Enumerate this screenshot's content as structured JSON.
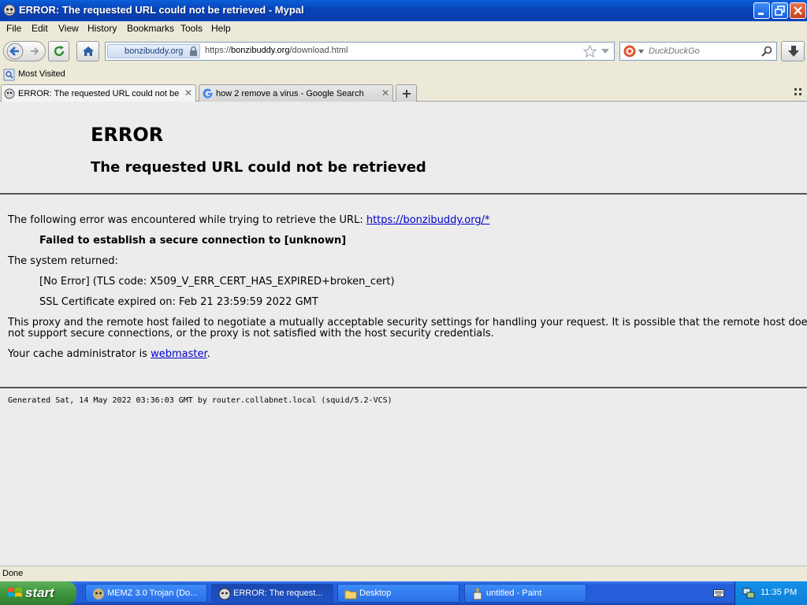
{
  "window": {
    "title": "ERROR: The requested URL could not be retrieved - Mypal",
    "colors": {
      "titlebar": "#0a4ac6",
      "close": "#d3502c"
    }
  },
  "menu": [
    "File",
    "Edit",
    "View",
    "History",
    "Bookmarks",
    "Tools",
    "Help"
  ],
  "nav": {
    "identity": "bonzibuddy.org",
    "url_prefix": "https://",
    "url_host": "bonzibuddy.org",
    "url_path": "/download.html",
    "search_placeholder": "DuckDuckGo"
  },
  "bookmarks": {
    "most_visited": "Most Visited"
  },
  "tabs": [
    {
      "label": "ERROR: The requested URL could not be retrieved",
      "active": true
    },
    {
      "label": "how 2 remove a virus - Google Search",
      "active": false
    }
  ],
  "page": {
    "title": "ERROR",
    "subtitle": "The requested URL could not be retrieved",
    "intro": "The following error was encountered while trying to retrieve the URL: ",
    "intro_link": "https://bonzibuddy.org/*",
    "failure": "Failed to establish a secure connection to [unknown]",
    "system_returned": "The system returned:",
    "no_error": "[No Error] (TLS code: X509_V_ERR_CERT_HAS_EXPIRED+broken_cert)",
    "cert_expired": "SSL Certificate expired on: Feb 21 23:59:59 2022 GMT",
    "explanation_line1": "This proxy and the remote host failed to negotiate a mutually acceptable security settings for handling your request. It is possible that the remote host does",
    "explanation_line2": "not support secure connections, or the proxy is not satisfied with the host security credentials.",
    "admin_prefix": "Your cache administrator is ",
    "admin_link": "webmaster",
    "admin_suffix": ".",
    "footer": "Generated Sat, 14 May 2022 03:36:03 GMT by router.collabnet.local (squid/5.2-VCS)"
  },
  "status": "Done",
  "taskbar": {
    "start": "start",
    "tasks": [
      {
        "label": "MEMZ 3.0 Trojan (Do...",
        "icon": "memz-icon"
      },
      {
        "label": "ERROR: The request...",
        "icon": "mypal-icon"
      },
      {
        "label": "Desktop",
        "icon": "folder-icon"
      },
      {
        "label": "untitled - Paint",
        "icon": "paint-icon"
      }
    ],
    "clock": "11:35 PM"
  }
}
